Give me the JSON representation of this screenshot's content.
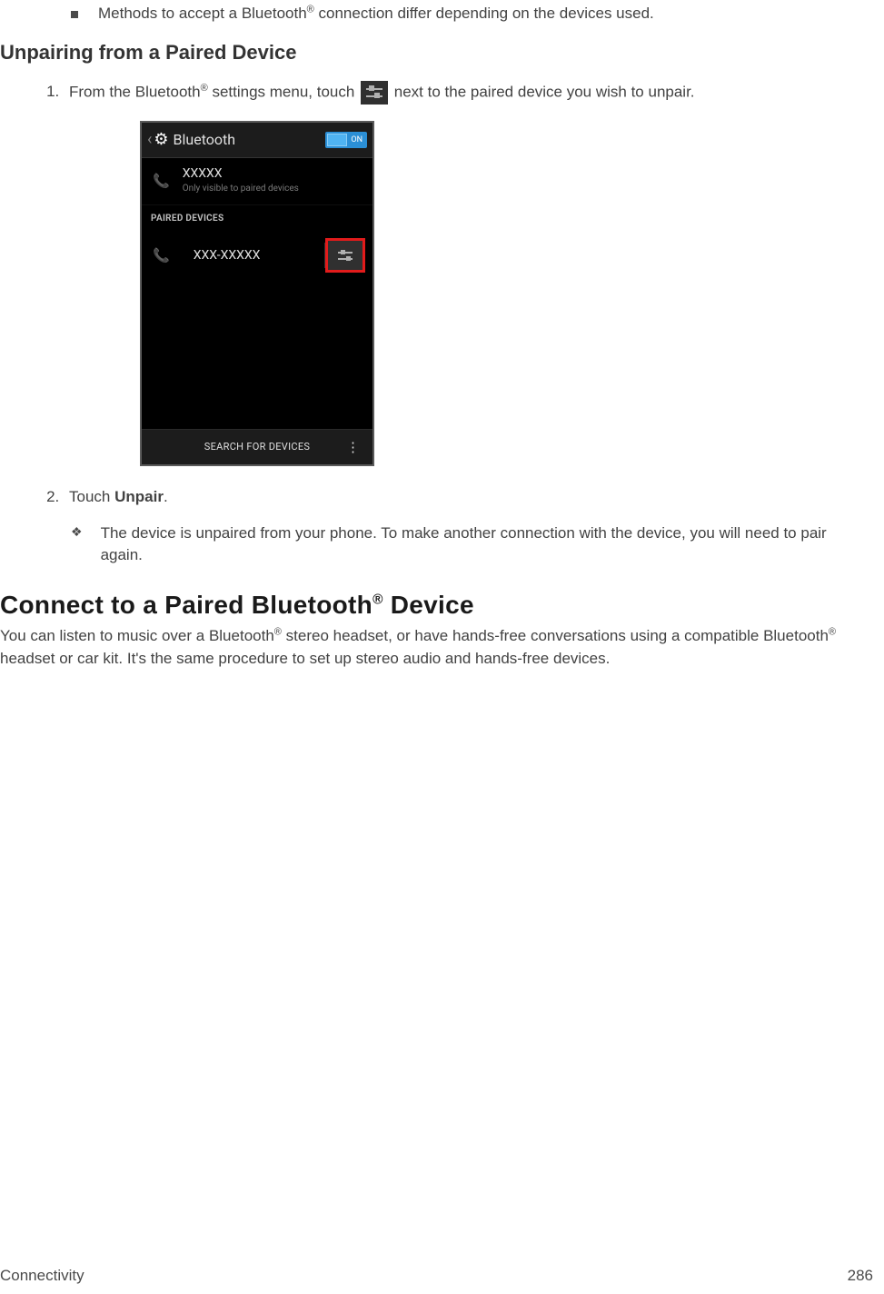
{
  "top_bullet": {
    "prefix": "Methods to accept a Bluetooth",
    "sup": "®",
    "suffix": " connection differ depending on the devices used."
  },
  "heading_unpairing": "Unpairing from a Paired Device",
  "steps": {
    "step1_prefix": "From the Bluetooth",
    "step1_sup": "®",
    "step1_mid": " settings menu, touch ",
    "step1_suffix": " next to the paired device you wish to unpair.",
    "step2_prefix": "Touch ",
    "step2_bold": "Unpair",
    "step2_suffix": "."
  },
  "result_note": "The device is unpaired from your phone. To make another connection with the device, you will need to pair again.",
  "phone": {
    "title": "Bluetooth",
    "toggle_label": "ON",
    "own_name": "XXXXX",
    "own_sub": "Only visible to paired devices",
    "section_label": "PAIRED DEVICES",
    "paired_name": "XXX-XXXXX",
    "footer": "SEARCH FOR DEVICES"
  },
  "heading_connect_prefix": "Connect to a Paired Bluetooth",
  "heading_connect_sup": "®",
  "heading_connect_suffix": " Device",
  "connect_para": {
    "p1": "You can listen to music over a Bluetooth",
    "s1": "®",
    "p2": " stereo headset, or have hands-free conversations using a compatible Bluetooth",
    "s2": "®",
    "p3": " headset or car kit. It's the same procedure to set up stereo audio and hands-free devices."
  },
  "footer_left": "Connectivity",
  "footer_right": "286"
}
